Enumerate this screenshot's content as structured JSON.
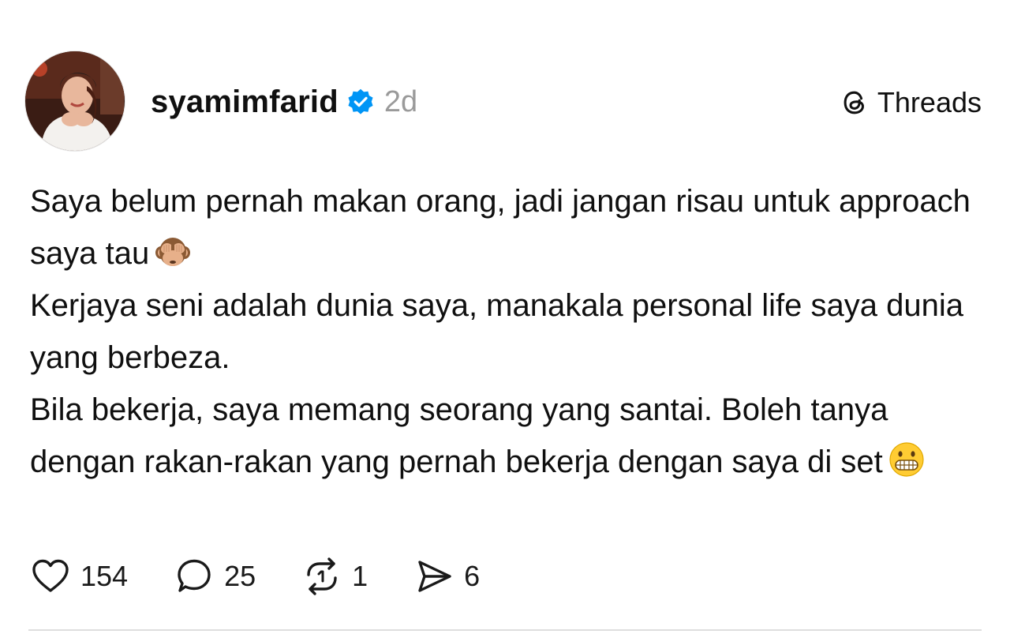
{
  "post": {
    "username": "syamimfarid",
    "verified": true,
    "timestamp": "2d",
    "brand": "Threads",
    "body": [
      {
        "text": "Saya belum pernah makan orang, jadi jangan risau untuk approach saya tau",
        "emoji": "see-no-evil-monkey"
      },
      {
        "text": "Kerjaya seni adalah dunia saya, manakala personal life saya dunia yang berbeza.",
        "emoji": ""
      },
      {
        "text": "Bila bekerja, saya memang seorang yang santai. Boleh tanya dengan rakan-rakan yang pernah bekerja dengan saya di set",
        "emoji": "grimacing-face"
      }
    ],
    "actions": {
      "likes": "154",
      "replies": "25",
      "reposts": "1",
      "shares": "6"
    }
  },
  "icons": {
    "like": "heart-icon",
    "reply": "speech-bubble-icon",
    "repost": "repost-icon",
    "share": "send-icon",
    "verified": "verified-badge-icon",
    "brand": "threads-logo-icon"
  },
  "colors": {
    "verified_blue": "#0095f6",
    "timestamp_gray": "#9a9a9a",
    "text": "#101010"
  }
}
